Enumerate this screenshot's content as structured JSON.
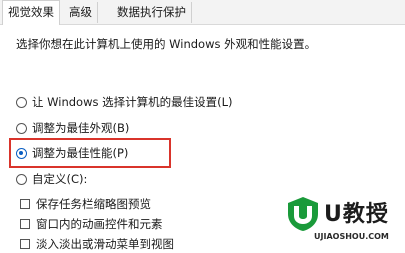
{
  "tabs": [
    {
      "label": "视觉效果",
      "active": true
    },
    {
      "label": "高级",
      "active": false
    },
    {
      "label": "数据执行保护",
      "active": false
    }
  ],
  "description": "选择你想在此计算机上使用的 Windows 外观和性能设置。",
  "options": [
    {
      "label": "让 Windows 选择计算机的最佳设置(L)",
      "checked": false
    },
    {
      "label": "调整为最佳外观(B)",
      "checked": false
    },
    {
      "label": "调整为最佳性能(P)",
      "checked": true
    },
    {
      "label": "自定义(C):",
      "checked": false
    }
  ],
  "custom_items": [
    {
      "label": "保存任务栏缩略图预览",
      "checked": false
    },
    {
      "label": "窗口内的动画控件和元素",
      "checked": false
    },
    {
      "label": "淡入淡出或滑动菜单到视图",
      "checked": false
    }
  ],
  "watermark": {
    "logo_text": "U教授",
    "domain": "UJIAOSHOU.COM",
    "color": "#1a9a3a"
  },
  "highlight_color": "#d9342b"
}
